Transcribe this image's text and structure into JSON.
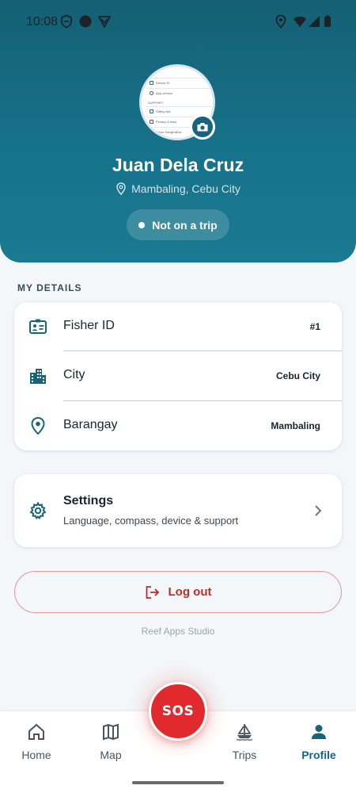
{
  "status_bar": {
    "time": "10:08",
    "left_icons": [
      "shield-icon",
      "dot-icon",
      "vpn-icon"
    ],
    "right_icons": [
      "location-icon",
      "wifi-icon",
      "signal-icon",
      "battery-icon"
    ]
  },
  "profile": {
    "name": "Juan Dela Cruz",
    "location": "Mambaling, Cebu City",
    "trip_status": "Not on a trip",
    "avatar_preview_lines": [
      "Device ID",
      "App version",
      "Safety tips",
      "Privacy & data",
      "About DangKaBot"
    ],
    "avatar_preview_sections": [
      "SUPPORT"
    ]
  },
  "details": {
    "section_title": "MY DETAILS",
    "rows": [
      {
        "label": "Fisher ID",
        "value": "#1",
        "icon": "id-card-icon"
      },
      {
        "label": "City",
        "value": "Cebu City",
        "icon": "city-buildings-icon"
      },
      {
        "label": "Barangay",
        "value": "Mambaling",
        "icon": "map-pin-icon"
      }
    ]
  },
  "settings": {
    "title": "Settings",
    "subtitle": "Language, compass, device & support",
    "icon": "gear-icon"
  },
  "logout": {
    "label": "Log out",
    "icon": "logout-icon"
  },
  "footer": {
    "text": "Reef Apps Studio"
  },
  "sos": {
    "label": "SOS"
  },
  "nav": {
    "items": [
      {
        "label": "Home",
        "icon": "home-icon",
        "active": false
      },
      {
        "label": "Map",
        "icon": "map-icon",
        "active": false
      },
      {
        "label": "Trips",
        "icon": "boat-icon",
        "active": false
      },
      {
        "label": "Profile",
        "icon": "profile-icon",
        "active": true
      }
    ]
  },
  "colors": {
    "header": "#16728a",
    "accent": "#17647b",
    "sos": "#e02a2e",
    "logout": "#c22a2a"
  }
}
